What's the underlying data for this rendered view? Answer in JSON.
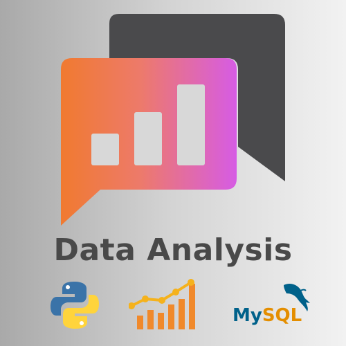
{
  "title": "Data Analysis",
  "logos": {
    "python": {
      "icon": "python-logo-icon"
    },
    "chart": {
      "icon": "growth-chart-icon"
    },
    "mysql": {
      "icon": "mysql-logo-icon",
      "text_my": "My",
      "text_sql": "SQL"
    }
  },
  "colors": {
    "bubble_gradient_start": "#f07a30",
    "bubble_gradient_end": "#d65ce4",
    "back_bubble": "#4a4a4c",
    "bars": "#d8d8d8",
    "title": "#494949",
    "python_blue": "#3a73a8",
    "python_yellow": "#ffd43b",
    "orange": "#f0892b",
    "mysql_blue": "#00618a",
    "mysql_orange": "#e48e00"
  }
}
